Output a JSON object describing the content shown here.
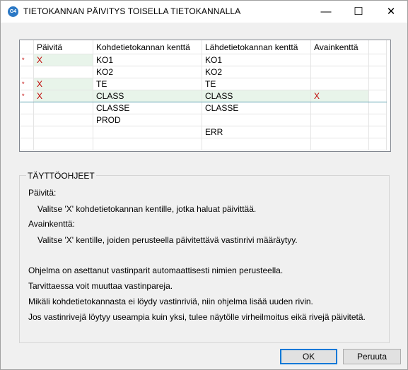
{
  "window": {
    "app_icon": "G4",
    "title": "TIETOKANNAN PÄIVITYS TOISELLA TIETOKANNALLA",
    "controls": {
      "minimize": "—",
      "maximize": "☐",
      "close": "✕"
    }
  },
  "grid": {
    "columns": [
      "Päivitä",
      "Kohdetietokannan kenttä",
      "Lähdetietokannan kenttä",
      "Avainkenttä"
    ],
    "rows": [
      {
        "marker": "*",
        "paivita": "X",
        "kohde": "KO1",
        "lahde": "KO1",
        "avain": ""
      },
      {
        "marker": "",
        "paivita": "",
        "kohde": "KO2",
        "lahde": "KO2",
        "avain": ""
      },
      {
        "marker": "*",
        "paivita": "X",
        "kohde": "TE",
        "lahde": "TE",
        "avain": ""
      },
      {
        "marker": "*",
        "paivita": "X",
        "kohde": "CLASS",
        "lahde": "CLASS",
        "avain": "X"
      },
      {
        "marker": "",
        "paivita": "",
        "kohde": "CLASSE",
        "lahde": "CLASSE",
        "avain": ""
      },
      {
        "marker": "",
        "paivita": "",
        "kohde": "PROD",
        "lahde": "",
        "avain": ""
      },
      {
        "marker": "",
        "paivita": "",
        "kohde": "",
        "lahde": "ERR",
        "avain": ""
      }
    ]
  },
  "instructions": {
    "title": "TÄYTTÖOHJEET",
    "paivita_label": "Päivitä:",
    "paivita_text": "Valitse 'X' kohdetietokannan kentille, jotka haluat päivittää.",
    "avain_label": "Avainkenttä:",
    "avain_text": "Valitse 'X' kentille, joiden perusteella päivitettävä vastinrivi määräytyy.",
    "lines": [
      "Ohjelma on asettanut vastinparit automaattisesti nimien perusteella.",
      "Tarvittaessa voit muuttaa vastinpareja.",
      "Mikäli kohdetietokannasta ei löydy vastinriviä, niin ohjelma lisää uuden rivin.",
      "Jos vastinrivejä löytyy useampia kuin yksi, tulee näytölle virheilmoitus eikä rivejä päivitetä."
    ]
  },
  "buttons": {
    "ok": "OK",
    "cancel": "Peruuta"
  }
}
